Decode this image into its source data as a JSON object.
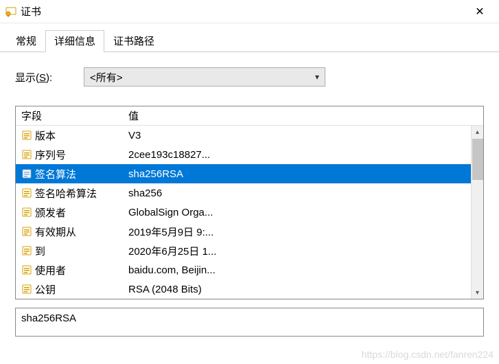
{
  "window": {
    "title": "证书",
    "close_glyph": "✕"
  },
  "tabs": {
    "general": "常规",
    "details": "详细信息",
    "path": "证书路径",
    "active_index": 1
  },
  "show": {
    "label_pre": "显示(",
    "label_hot": "S",
    "label_post": "):",
    "selected": "<所有>"
  },
  "columns": {
    "field": "字段",
    "value": "值"
  },
  "rows": [
    {
      "field": "版本",
      "value": "V3"
    },
    {
      "field": "序列号",
      "value": "2cee193c18827..."
    },
    {
      "field": "签名算法",
      "value": "sha256RSA",
      "selected": true
    },
    {
      "field": "签名哈希算法",
      "value": "sha256"
    },
    {
      "field": "颁发者",
      "value": "GlobalSign Orga..."
    },
    {
      "field": "有效期从",
      "value": "2019年5月9日 9:..."
    },
    {
      "field": "到",
      "value": "2020年6月25日 1..."
    },
    {
      "field": "使用者",
      "value": "baidu.com, Beijin..."
    },
    {
      "field": "公钥",
      "value": "RSA (2048 Bits)"
    }
  ],
  "detail_value": "sha256RSA",
  "watermark": "https://blog.csdn.net/fanren224"
}
